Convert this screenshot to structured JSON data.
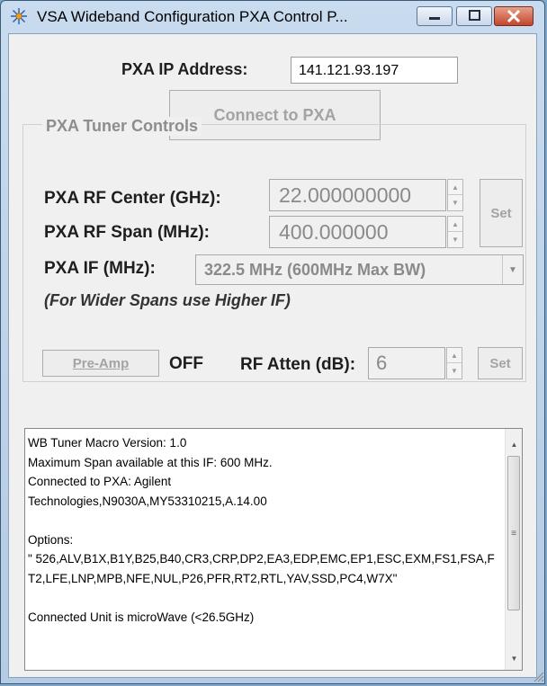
{
  "window": {
    "title": "VSA Wideband Configuration PXA Control P..."
  },
  "connection": {
    "ip_label": "PXA IP Address:",
    "ip_value": "141.121.93.197",
    "connect_label": "Connect to PXA"
  },
  "tuner": {
    "group_title": "PXA Tuner Controls",
    "rf_center_label": "PXA RF Center (GHz):",
    "rf_center_value": "22.000000000",
    "rf_span_label": "PXA RF Span (MHz):",
    "rf_span_value": "400.000000",
    "set_label": "Set",
    "if_label": "PXA IF (MHz):",
    "if_selected": "322.5 MHz  (600MHz Max BW)",
    "hint": "(For Wider Spans use Higher IF)",
    "preamp_label": "Pre-Amp",
    "preamp_state": "OFF",
    "atten_label": "RF Atten (dB):",
    "atten_value": "6",
    "atten_set_label": "Set"
  },
  "log": {
    "text": "WB Tuner Macro Version: 1.0\nMaximum Span available at this IF: 600 MHz.\nConnected to PXA: Agilent\nTechnologies,N9030A,MY53310215,A.14.00\n\nOptions:\n\" 526,ALV,B1X,B1Y,B25,B40,CR3,CRP,DP2,EA3,EDP,EMC,EP1,ESC,EXM,FS1,FSA,FT2,LFE,LNP,MPB,NFE,NUL,P26,PFR,RT2,RTL,YAV,SSD,PC4,W7X\"\n\nConnected Unit is microWave (<26.5GHz)"
  },
  "icons": {
    "app": "sun-icon",
    "minimize": "minimize-icon",
    "maximize": "maximize-icon",
    "close": "close-icon"
  }
}
